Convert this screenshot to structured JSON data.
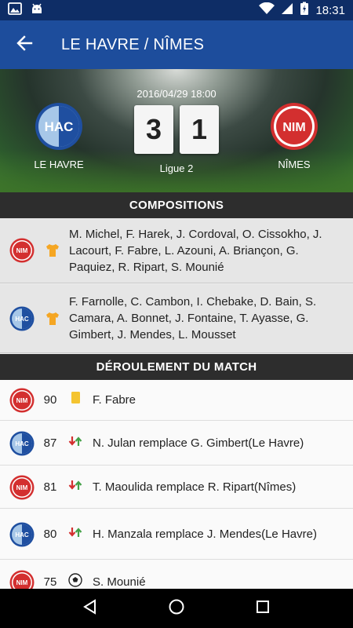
{
  "status_bar": {
    "time": "18:31",
    "icons": [
      "gallery-icon",
      "android-icon",
      "wifi-icon",
      "signal-icon",
      "battery-charging-icon"
    ]
  },
  "header": {
    "title": "LE HAVRE / NÎMES",
    "back_icon": "arrow-left-icon"
  },
  "match": {
    "datetime": "2016/04/29 18:00",
    "competition": "Ligue 2",
    "home": {
      "name": "LE HAVRE",
      "abbr": "HAC",
      "score": "3",
      "colors": {
        "primary": "#1f4fa0",
        "light": "#a7c7e8"
      }
    },
    "away": {
      "name": "NÎMES",
      "abbr": "NIM",
      "score": "1",
      "colors": {
        "primary": "#d32f2f",
        "light": "#ffffff"
      }
    }
  },
  "compositions": {
    "title": "COMPOSITIONS",
    "lineups": [
      {
        "team_abbr": "NIM",
        "players": "M. Michel, F. Harek, J. Cordoval, O. Cissokho, J. Lacourt, F. Fabre, L. Azouni, A. Briançon, G. Paquiez, R. Ripart, S. Mounié"
      },
      {
        "team_abbr": "HAC",
        "players": "F. Farnolle, C. Cambon, I. Chebake, D. Bain, S. Camara, A. Bonnet, J. Fontaine, T. Ayasse, G. Gimbert, J. Mendes, L. Mousset"
      }
    ]
  },
  "events": {
    "title": "DÉROULEMENT DU MATCH",
    "items": [
      {
        "team_abbr": "NIM",
        "minute": "90",
        "type": "yellow-card-icon",
        "text": "F. Fabre"
      },
      {
        "team_abbr": "HAC",
        "minute": "87",
        "type": "substitution-icon",
        "text": "N. Julan remplace G. Gimbert(Le Havre)"
      },
      {
        "team_abbr": "NIM",
        "minute": "81",
        "type": "substitution-icon",
        "text": "T. Maoulida remplace R. Ripart(Nîmes)"
      },
      {
        "team_abbr": "HAC",
        "minute": "80",
        "type": "substitution-icon",
        "text": "H. Manzala remplace J. Mendes(Le Havre)"
      },
      {
        "team_abbr": "NIM",
        "minute": "75",
        "type": "goal-ball-icon",
        "text": "S. Mounié"
      }
    ]
  },
  "nav_bar": {
    "buttons": [
      "back-triangle-icon",
      "home-circle-icon",
      "recents-square-icon"
    ]
  },
  "theme": {
    "statusbar": "#0e2d66",
    "appbar": "#1d4d9c",
    "section_header": "#2d2d2d",
    "shirt": "#f5a623"
  }
}
